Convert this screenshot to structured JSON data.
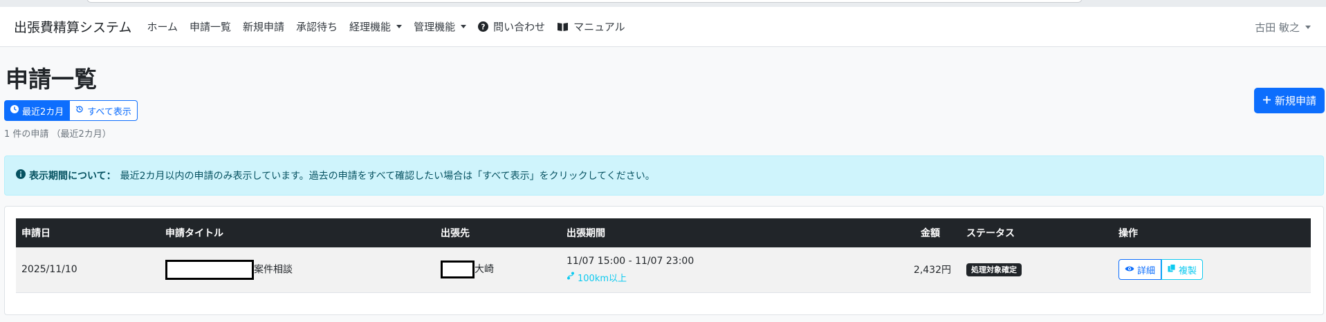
{
  "navbar": {
    "brand": "出張費精算システム",
    "items": [
      {
        "label": "ホーム"
      },
      {
        "label": "申請一覧"
      },
      {
        "label": "新規申請"
      },
      {
        "label": "承認待ち"
      },
      {
        "label": "経理機能"
      },
      {
        "label": "管理機能"
      },
      {
        "label": "問い合わせ"
      },
      {
        "label": "マニュアル"
      }
    ],
    "user": "古田 敏之"
  },
  "page": {
    "title": "申請一覧",
    "filter_recent": "最近2カ月",
    "filter_all": "すべて表示",
    "count_text": "1 件の申請 （最近2カ月）",
    "new_button": "新規申請"
  },
  "alert": {
    "title": "表示期間について：",
    "message": "最近2カ月以内の申請のみ表示しています。過去の申請をすべて確認したい場合は「すべて表示」をクリックしてください。"
  },
  "table": {
    "headers": [
      "申請日",
      "申請タイトル",
      "出張先",
      "出張期間",
      "金額",
      "ステータス",
      "操作"
    ],
    "rows": [
      {
        "date": "2025/11/10",
        "title_suffix": "案件相談",
        "destination_suffix": "大崎",
        "period": "11/07 15:00 - 11/07 23:00",
        "distance": "100km以上",
        "amount": "2,432円",
        "status": "処理対象確定",
        "detail_label": "詳細",
        "copy_label": "複製"
      }
    ]
  },
  "colors": {
    "primary": "#0d6efd",
    "info": "#0dcaf0",
    "dark": "#212529",
    "alert_bg": "#cff4fc"
  }
}
